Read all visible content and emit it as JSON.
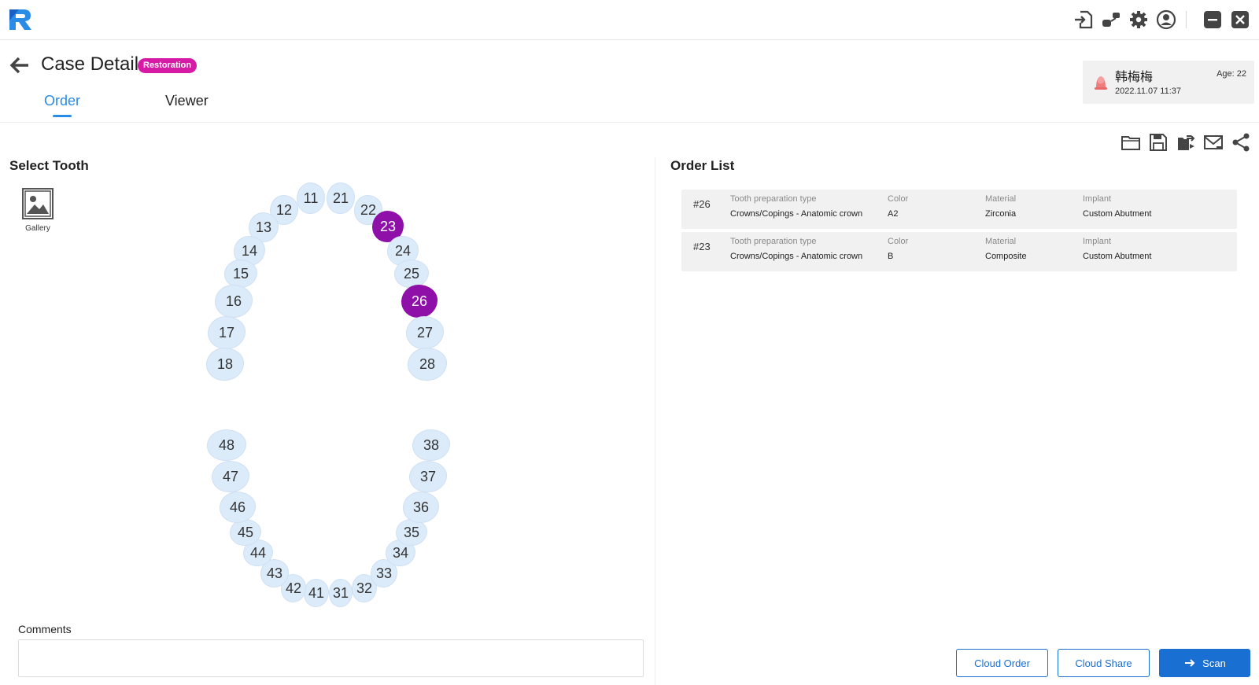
{
  "app": {
    "logo_icon": "app-logo-icon",
    "accent_color": "#2a8ce6",
    "brand_blue": "#1a6fd3"
  },
  "topbar": {
    "icons": [
      "import-icon",
      "connect-icon",
      "settings-icon",
      "user-icon",
      "minimize-icon",
      "close-icon"
    ]
  },
  "header": {
    "title": "Case Detail",
    "badge": "Restoration",
    "badge_color": "#d61aa6",
    "tabs": [
      {
        "label": "Order",
        "active": true
      },
      {
        "label": "Viewer",
        "active": false
      }
    ]
  },
  "patient": {
    "name": "韩梅梅",
    "datetime": "2022.11.07 11:37",
    "age": "Age: 22"
  },
  "left": {
    "title": "Select Tooth",
    "gallery_label": "Gallery",
    "selected_color": "#8f10a8",
    "teeth": [
      {
        "num": "11",
        "selected": false
      },
      {
        "num": "12",
        "selected": false
      },
      {
        "num": "13",
        "selected": false
      },
      {
        "num": "14",
        "selected": false
      },
      {
        "num": "15",
        "selected": false
      },
      {
        "num": "16",
        "selected": false
      },
      {
        "num": "17",
        "selected": false
      },
      {
        "num": "18",
        "selected": false
      },
      {
        "num": "21",
        "selected": false
      },
      {
        "num": "22",
        "selected": false
      },
      {
        "num": "23",
        "selected": true
      },
      {
        "num": "24",
        "selected": false
      },
      {
        "num": "25",
        "selected": false
      },
      {
        "num": "26",
        "selected": true
      },
      {
        "num": "27",
        "selected": false
      },
      {
        "num": "28",
        "selected": false
      },
      {
        "num": "31",
        "selected": false
      },
      {
        "num": "32",
        "selected": false
      },
      {
        "num": "33",
        "selected": false
      },
      {
        "num": "34",
        "selected": false
      },
      {
        "num": "35",
        "selected": false
      },
      {
        "num": "36",
        "selected": false
      },
      {
        "num": "37",
        "selected": false
      },
      {
        "num": "38",
        "selected": false
      },
      {
        "num": "41",
        "selected": false
      },
      {
        "num": "42",
        "selected": false
      },
      {
        "num": "43",
        "selected": false
      },
      {
        "num": "44",
        "selected": false
      },
      {
        "num": "45",
        "selected": false
      },
      {
        "num": "46",
        "selected": false
      },
      {
        "num": "47",
        "selected": false
      },
      {
        "num": "48",
        "selected": false
      }
    ],
    "comments_label": "Comments",
    "comments_value": ""
  },
  "right": {
    "title": "Order List",
    "toolbar_icons": [
      "folder-icon",
      "save-icon",
      "export-icon",
      "mail-icon",
      "share-icon"
    ],
    "columns": [
      "Tooth preparation type",
      "Color",
      "Material",
      "Implant"
    ],
    "orders": [
      {
        "num": "#26",
        "prep_type": "Crowns/Copings - Anatomic crown",
        "color": "A2",
        "material": "Zirconia",
        "implant": "Custom Abutment"
      },
      {
        "num": "#23",
        "prep_type": "Crowns/Copings - Anatomic crown",
        "color": "B",
        "material": "Composite",
        "implant": "Custom Abutment"
      }
    ]
  },
  "footer": {
    "cloud_order": "Cloud Order",
    "cloud_share": "Cloud Share",
    "scan": "Scan"
  }
}
